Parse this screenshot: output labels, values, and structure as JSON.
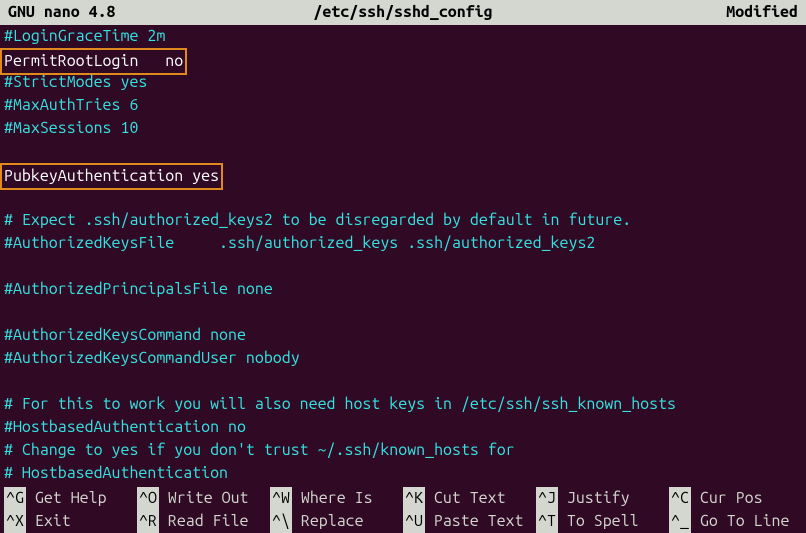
{
  "titlebar": {
    "app": "  GNU nano  4.8",
    "filepath": "/etc/ssh/sshd_config",
    "status": "Modified"
  },
  "lines": {
    "l0": "#LoginGraceTime 2m",
    "l1": "PermitRootLogin   no",
    "l2": "#StrictModes yes",
    "l3": "#MaxAuthTries 6",
    "l4": "#MaxSessions 10",
    "l5": "",
    "l6": "PubkeyAuthentication yes",
    "l7": "",
    "l8": "# Expect .ssh/authorized_keys2 to be disregarded by default in future.",
    "l9": "#AuthorizedKeysFile     .ssh/authorized_keys .ssh/authorized_keys2",
    "l10": "",
    "l11": "#AuthorizedPrincipalsFile none",
    "l12": "",
    "l13": "#AuthorizedKeysCommand none",
    "l14": "#AuthorizedKeysCommandUser nobody",
    "l15": "",
    "l16": "# For this to work you will also need host keys in /etc/ssh/ssh_known_hosts",
    "l17": "#HostbasedAuthentication no",
    "l18": "# Change to yes if you don't trust ~/.ssh/known_hosts for",
    "l19": "# HostbasedAuthentication"
  },
  "footer": {
    "row1": {
      "k1": "^G",
      "l1": " Get Help  ",
      "k2": "^O",
      "l2": " Write Out ",
      "k3": "^W",
      "l3": " Where Is  ",
      "k4": "^K",
      "l4": " Cut Text  ",
      "k5": "^J",
      "l5": " Justify   ",
      "k6": "^C",
      "l6": " Cur Pos   "
    },
    "row2": {
      "k1": "^X",
      "l1": " Exit      ",
      "k2": "^R",
      "l2": " Read File ",
      "k3": "^\\",
      "l3": " Replace   ",
      "k4": "^U",
      "l4": " Paste Text",
      "k5": "^T",
      "l5": " To Spell  ",
      "k6": "^_",
      "l6": " Go To Line"
    }
  }
}
